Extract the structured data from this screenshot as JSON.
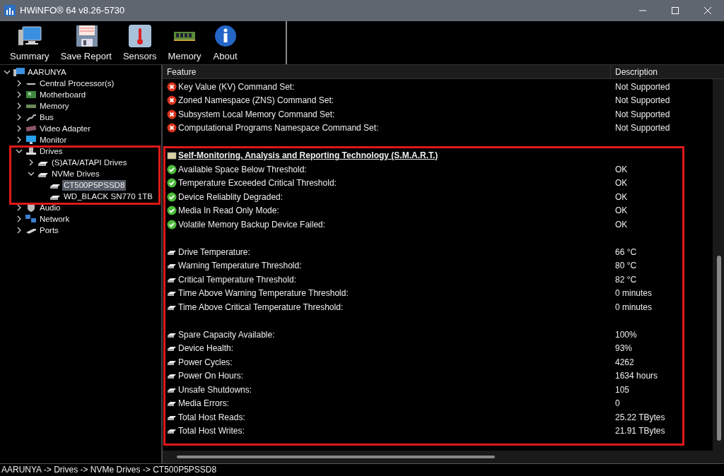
{
  "window": {
    "title": "HWiNFO® 64 v8.26-5730"
  },
  "toolbar": [
    {
      "label": "Summary",
      "kind": "computer"
    },
    {
      "label": "Save Report",
      "kind": "floppy"
    },
    {
      "label": "Sensors",
      "kind": "thermometer"
    },
    {
      "label": "Memory",
      "kind": "memory"
    },
    {
      "label": "About",
      "kind": "info"
    }
  ],
  "tree": [
    {
      "label": "AARUNYA",
      "kind": "computer",
      "expanded": true,
      "selected": false,
      "children": [
        {
          "label": "Central Processor(s)",
          "kind": "cpu",
          "expanded": false,
          "selected": false
        },
        {
          "label": "Motherboard",
          "kind": "board",
          "expanded": false,
          "selected": false
        },
        {
          "label": "Memory",
          "kind": "memory",
          "expanded": false,
          "selected": false
        },
        {
          "label": "Bus",
          "kind": "bus",
          "expanded": false,
          "selected": false
        },
        {
          "label": "Video Adapter",
          "kind": "video",
          "expanded": false,
          "selected": false
        },
        {
          "label": "Monitor",
          "kind": "monitor",
          "expanded": false,
          "selected": false
        },
        {
          "label": "Drives",
          "kind": "drive",
          "expanded": true,
          "selected": false,
          "children": [
            {
              "label": "(S)ATA/ATAPI Drives",
              "kind": "disk",
              "expanded": false,
              "selected": false
            },
            {
              "label": "NVMe Drives",
              "kind": "disk",
              "expanded": true,
              "selected": false,
              "children": [
                {
                  "label": "CT500P5PSSD8",
                  "kind": "disk",
                  "selected": true
                },
                {
                  "label": "WD_BLACK SN770 1TB",
                  "kind": "disk",
                  "selected": false
                }
              ]
            }
          ]
        },
        {
          "label": "Audio",
          "kind": "audio",
          "expanded": false,
          "selected": false
        },
        {
          "label": "Network",
          "kind": "network",
          "expanded": false,
          "selected": false
        },
        {
          "label": "Ports",
          "kind": "ports",
          "expanded": false,
          "selected": false
        }
      ]
    }
  ],
  "table": {
    "columns": [
      "Feature",
      "Description"
    ],
    "rows": [
      {
        "kind": "error",
        "feature": "Key Value (KV) Command Set:",
        "description": "Not Supported"
      },
      {
        "kind": "error",
        "feature": "Zoned Namespace (ZNS) Command Set:",
        "description": "Not Supported"
      },
      {
        "kind": "error",
        "feature": "Subsystem Local Memory Command Set:",
        "description": "Not Supported"
      },
      {
        "kind": "error",
        "feature": "Computational Programs Namespace Command Set:",
        "description": "Not Supported"
      },
      {
        "kind": "spacer"
      },
      {
        "kind": "section",
        "feature": "Self-Monitoring, Analysis and Reporting Technology (S.M.A.R.T.)"
      },
      {
        "kind": "ok",
        "feature": "Available Space Below Threshold:",
        "description": "OK"
      },
      {
        "kind": "ok",
        "feature": "Temperature Exceeded Critical Threshold:",
        "description": "OK"
      },
      {
        "kind": "ok",
        "feature": "Device Reliablity Degraded:",
        "description": "OK"
      },
      {
        "kind": "ok",
        "feature": "Media In Read Only Mode:",
        "description": "OK"
      },
      {
        "kind": "ok",
        "feature": "Volatile Memory Backup Device Failed:",
        "description": "OK"
      },
      {
        "kind": "spacer"
      },
      {
        "kind": "drive",
        "feature": "Drive Temperature:",
        "description": "66 °C"
      },
      {
        "kind": "drive",
        "feature": "Warning Temperature Threshold:",
        "description": "80 °C"
      },
      {
        "kind": "drive",
        "feature": "Critical Temperature Threshold:",
        "description": "82 °C"
      },
      {
        "kind": "drive",
        "feature": "Time Above Warning Temperature Threshold:",
        "description": "0 minutes"
      },
      {
        "kind": "drive",
        "feature": "Time Above Critical Temperature Threshold:",
        "description": "0 minutes"
      },
      {
        "kind": "spacer"
      },
      {
        "kind": "drive",
        "feature": "Spare Capacity Available:",
        "description": "100%"
      },
      {
        "kind": "drive",
        "feature": "Device Health:",
        "description": "93%"
      },
      {
        "kind": "drive",
        "feature": "Power Cycles:",
        "description": "4262"
      },
      {
        "kind": "drive",
        "feature": "Power On Hours:",
        "description": "1634 hours"
      },
      {
        "kind": "drive",
        "feature": "Unsafe Shutdowns:",
        "description": "105"
      },
      {
        "kind": "drive",
        "feature": "Media Errors:",
        "description": "0"
      },
      {
        "kind": "drive",
        "feature": "Total Host Reads:",
        "description": "25.22 TBytes"
      },
      {
        "kind": "drive",
        "feature": "Total Host Writes:",
        "description": "21.91 TBytes"
      }
    ]
  },
  "status_bar": "AARUNYA -> Drives -> NVMe Drives -> CT500P5PSSD8"
}
